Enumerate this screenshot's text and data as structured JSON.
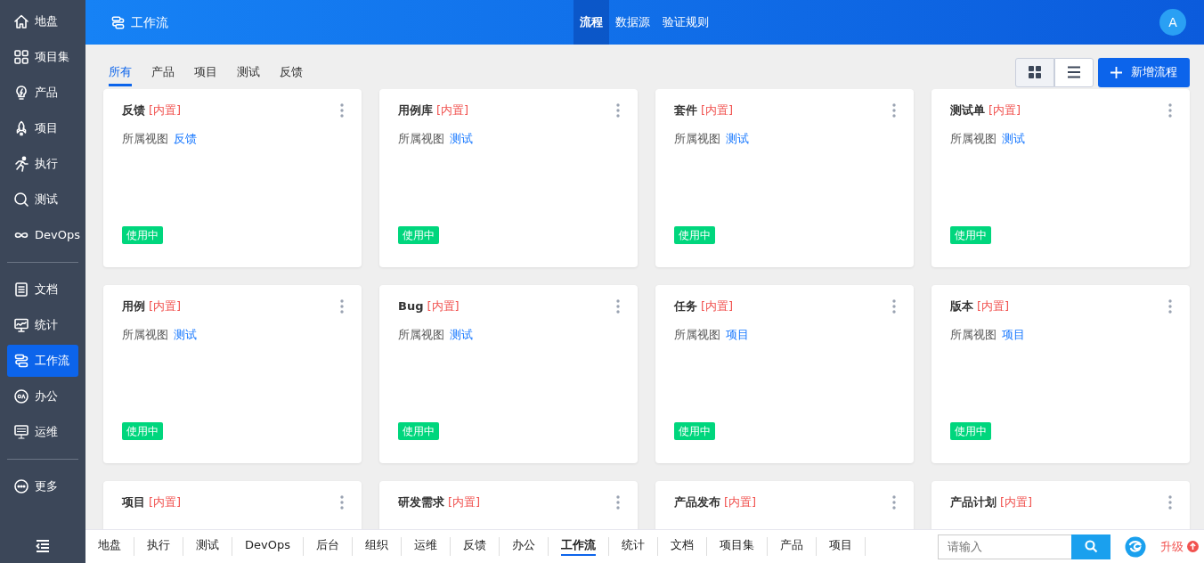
{
  "sidebar": {
    "groups": [
      [
        {
          "label": "地盘",
          "kind": "home",
          "selected": false
        },
        {
          "label": "项目集",
          "kind": "grid",
          "selected": false
        },
        {
          "label": "产品",
          "kind": "bulb",
          "selected": false
        },
        {
          "label": "项目",
          "kind": "rocket",
          "selected": false
        },
        {
          "label": "执行",
          "kind": "run",
          "selected": false
        },
        {
          "label": "测试",
          "kind": "search",
          "selected": false
        },
        {
          "label": "DevOps",
          "kind": "infinity",
          "selected": false
        }
      ],
      [
        {
          "label": "文档",
          "kind": "doc",
          "selected": false
        },
        {
          "label": "统计",
          "kind": "monitor",
          "selected": false
        },
        {
          "label": "工作流",
          "kind": "flow",
          "selected": true
        },
        {
          "label": "办公",
          "kind": "oa",
          "selected": false
        },
        {
          "label": "运维",
          "kind": "ops",
          "selected": false
        }
      ],
      [
        {
          "label": "更多",
          "kind": "more",
          "selected": false
        }
      ]
    ]
  },
  "header": {
    "title": "工作流",
    "tabs": [
      {
        "label": "流程",
        "selected": true
      },
      {
        "label": "数据源",
        "selected": false
      },
      {
        "label": "验证规则",
        "selected": false
      }
    ],
    "avatar": "A"
  },
  "filters": [
    {
      "label": "所有",
      "selected": true
    },
    {
      "label": "产品",
      "selected": false
    },
    {
      "label": "项目",
      "selected": false
    },
    {
      "label": "测试",
      "selected": false
    },
    {
      "label": "反馈",
      "selected": false
    }
  ],
  "view_toggle": [
    {
      "kind": "grid",
      "selected": true
    },
    {
      "kind": "list",
      "selected": false
    }
  ],
  "add_button": {
    "label": "新增流程"
  },
  "cards": [
    {
      "name": "反馈",
      "tag": "[内置]",
      "view_label": "所属视图",
      "view": "反馈",
      "status": "使用中"
    },
    {
      "name": "用例库",
      "tag": "[内置]",
      "view_label": "所属视图",
      "view": "测试",
      "status": "使用中"
    },
    {
      "name": "套件",
      "tag": "[内置]",
      "view_label": "所属视图",
      "view": "测试",
      "status": "使用中"
    },
    {
      "name": "测试单",
      "tag": "[内置]",
      "view_label": "所属视图",
      "view": "测试",
      "status": "使用中"
    },
    {
      "name": "用例",
      "tag": "[内置]",
      "view_label": "所属视图",
      "view": "测试",
      "status": "使用中"
    },
    {
      "name": "Bug",
      "tag": "[内置]",
      "view_label": "所属视图",
      "view": "测试",
      "status": "使用中"
    },
    {
      "name": "任务",
      "tag": "[内置]",
      "view_label": "所属视图",
      "view": "项目",
      "status": "使用中"
    },
    {
      "name": "版本",
      "tag": "[内置]",
      "view_label": "所属视图",
      "view": "项目",
      "status": "使用中"
    },
    {
      "name": "项目",
      "tag": "[内置]"
    },
    {
      "name": "研发需求",
      "tag": "[内置]"
    },
    {
      "name": "产品发布",
      "tag": "[内置]"
    },
    {
      "name": "产品计划",
      "tag": "[内置]"
    }
  ],
  "bottom_bar": {
    "links": [
      {
        "label": "地盘",
        "selected": false
      },
      {
        "label": "执行",
        "selected": false
      },
      {
        "label": "测试",
        "selected": false
      },
      {
        "label": "DevOps",
        "selected": false
      },
      {
        "label": "后台",
        "selected": false
      },
      {
        "label": "组织",
        "selected": false
      },
      {
        "label": "运维",
        "selected": false
      },
      {
        "label": "反馈",
        "selected": false
      },
      {
        "label": "办公",
        "selected": false
      },
      {
        "label": "工作流",
        "selected": true
      },
      {
        "label": "统计",
        "selected": false
      },
      {
        "label": "文档",
        "selected": false
      },
      {
        "label": "项目集",
        "selected": false
      },
      {
        "label": "产品",
        "selected": false
      },
      {
        "label": "项目",
        "selected": false
      }
    ],
    "search": {
      "placeholder": "请输入"
    },
    "upgrade": "升级"
  }
}
